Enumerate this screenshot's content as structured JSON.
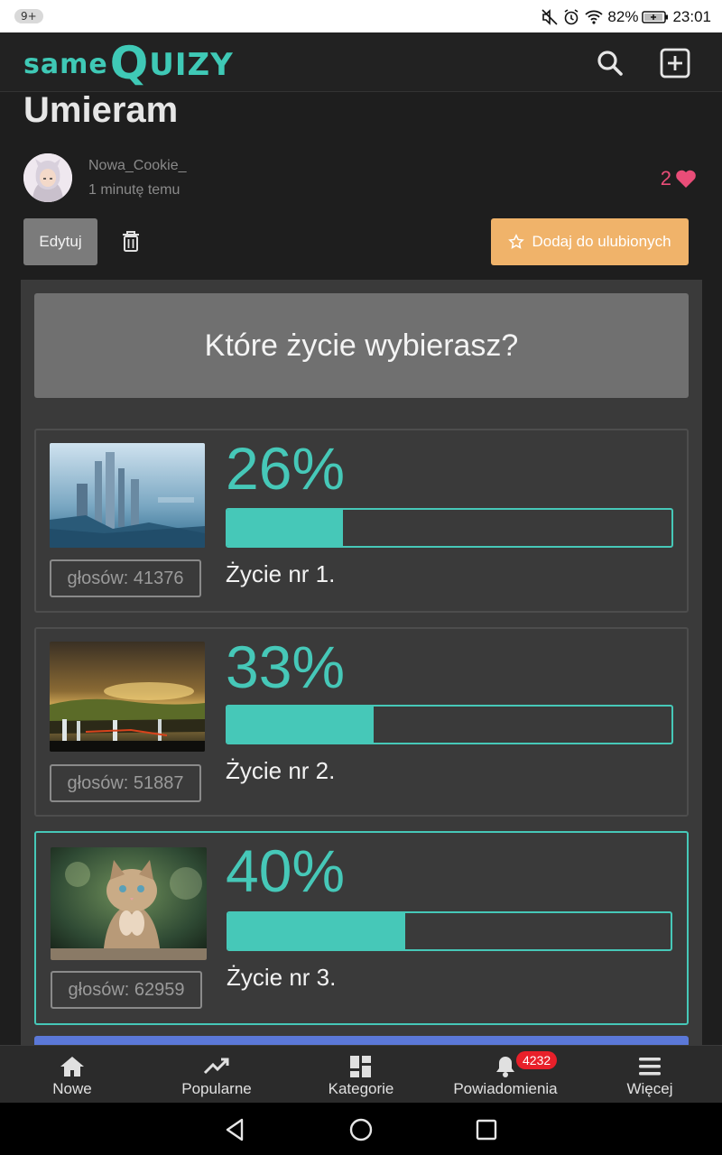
{
  "status_bar": {
    "badge": "9+",
    "battery": "82%",
    "time": "23:01"
  },
  "app": {
    "logo_same": "same",
    "logo_q": "Q",
    "logo_uizy": "UIZY"
  },
  "post": {
    "title": "Umieram",
    "author": "Nowa_Cookie_",
    "time": "1 minutę temu",
    "likes": "2",
    "edit_label": "Edytuj",
    "favorite_label": "Dodaj do ulubionych"
  },
  "quiz": {
    "question": "Które życie wybierasz?",
    "answers": [
      {
        "percent_label": "26%",
        "percent": 26,
        "label": "Życie nr 1.",
        "votes": "głosów: 41376",
        "image": "futuristic-city-image"
      },
      {
        "percent_label": "33%",
        "percent": 33,
        "label": "Życie nr 2.",
        "votes": "głosów: 51887",
        "image": "stormy-landscape-waterfall-image"
      },
      {
        "percent_label": "40%",
        "percent": 40,
        "label": "Życie nr 3.",
        "votes": "głosów: 62959",
        "image": "praying-kitten-image"
      }
    ]
  },
  "bottom_nav": {
    "items": [
      {
        "label": "Nowe",
        "icon": "home-icon"
      },
      {
        "label": "Popularne",
        "icon": "trending-icon"
      },
      {
        "label": "Kategorie",
        "icon": "dashboard-icon"
      },
      {
        "label": "Powiadomienia",
        "icon": "bell-icon",
        "badge": "4232"
      },
      {
        "label": "Więcej",
        "icon": "menu-icon"
      }
    ]
  },
  "colors": {
    "accent": "#46c8b8",
    "favorite": "#f0b36a",
    "heart": "#e94d78",
    "badge": "#e8202a"
  }
}
